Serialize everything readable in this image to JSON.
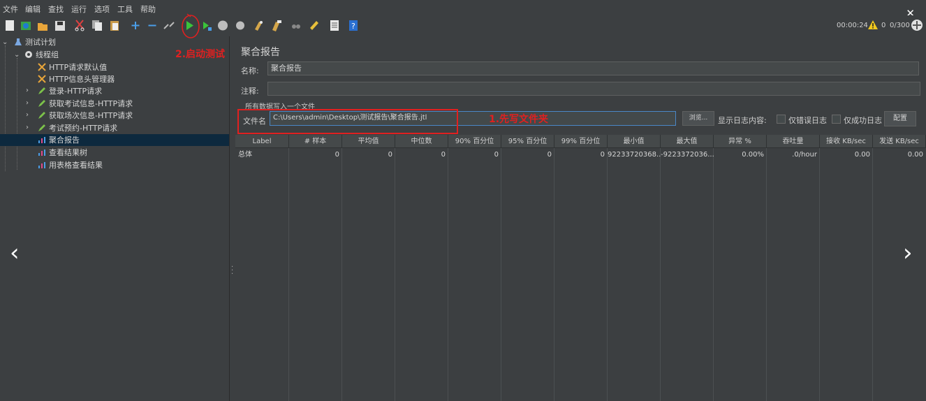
{
  "menu": [
    "文件",
    "编辑",
    "查找",
    "运行",
    "选项",
    "工具",
    "帮助"
  ],
  "status": {
    "timer": "00:00:24",
    "warnings": "0",
    "threads": "0/300"
  },
  "tree": {
    "plan": "测试计划",
    "thread_group": "线程组",
    "items": [
      "HTTP请求默认值",
      "HTTP信息头管理器",
      "登录-HTTP请求",
      "获取考试信息-HTTP请求",
      "获取场次信息-HTTP请求",
      "考试预约-HTTP请求",
      "聚合报告",
      "查看结果树",
      "用表格查看结果"
    ]
  },
  "panel": {
    "title": "聚合报告",
    "name_label": "名称:",
    "name_value": "聚合报告",
    "comment_label": "注释:",
    "comment_value": "",
    "group_label": "所有数据写入一个文件",
    "file_label": "文件名",
    "file_value": "C:\\Users\\admin\\Desktop\\测试报告\\聚合报告.jtl",
    "browse": "浏览...",
    "log_label": "显示日志内容:",
    "errors_only": "仅错误日志",
    "success_only": "仅成功日志",
    "configure": "配置"
  },
  "annotations": {
    "fill_file": "1.先写文件夹",
    "start_test": "2.启动测试"
  },
  "table": {
    "headers": [
      "Label",
      "# 样本",
      "平均值",
      "中位数",
      "90% 百分位",
      "95% 百分位",
      "99% 百分位",
      "最小值",
      "最大值",
      "异常 %",
      "吞吐量",
      "接收 KB/sec",
      "发送 KB/sec"
    ],
    "rows": [
      [
        "总体",
        "0",
        "0",
        "0",
        "0",
        "0",
        "0",
        "92233720368...",
        "-9223372036...",
        "0.00%",
        ".0/hour",
        "0.00",
        "0.00"
      ]
    ]
  },
  "colors": {
    "selection": "#0d293e",
    "highlight": "#e02020",
    "background": "#3c3f41"
  }
}
